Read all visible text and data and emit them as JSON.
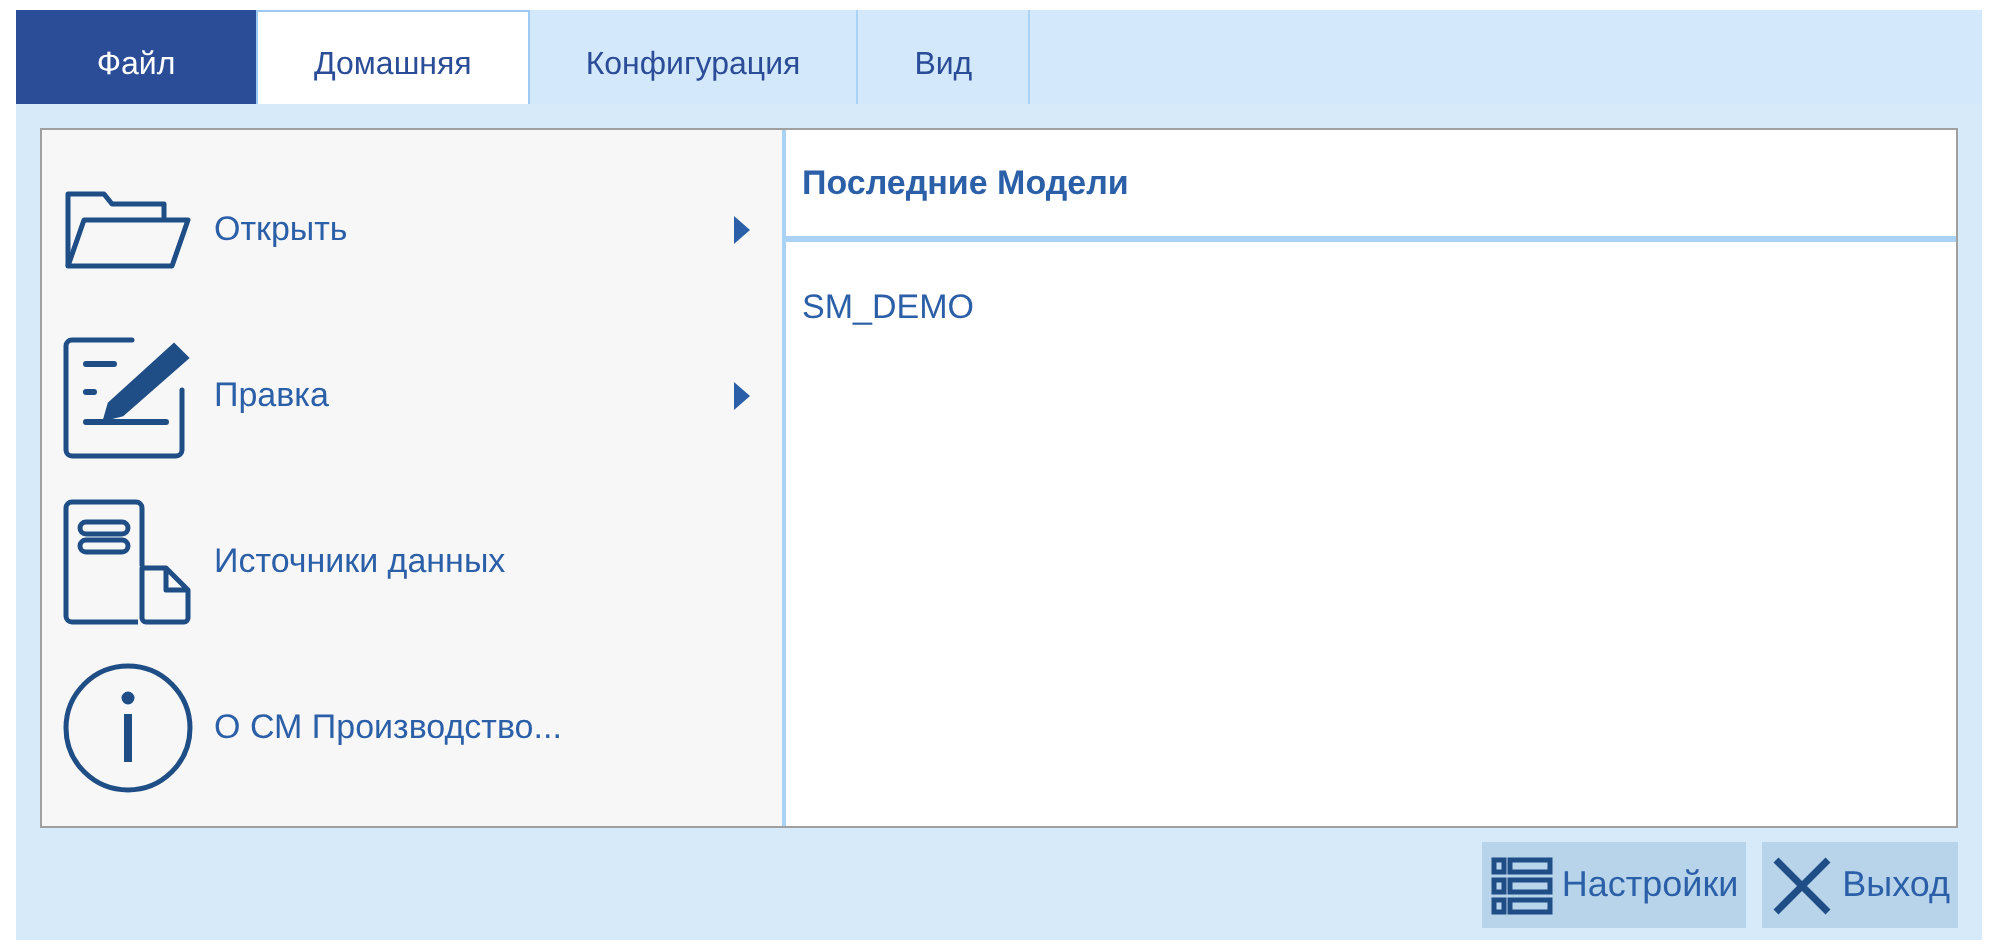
{
  "tabs": [
    {
      "label": "Файл",
      "selected": false,
      "kind": "file"
    },
    {
      "label": "Домашняя",
      "selected": true,
      "kind": "tab"
    },
    {
      "label": "Конфигурация",
      "selected": false,
      "kind": "tab"
    },
    {
      "label": "Вид",
      "selected": false,
      "kind": "tab"
    }
  ],
  "menu": {
    "items": [
      {
        "label": "Открыть",
        "has_submenu": true
      },
      {
        "label": "Правка",
        "has_submenu": true
      },
      {
        "label": "Источники данных",
        "has_submenu": false
      },
      {
        "label": "О СМ Производство...",
        "has_submenu": false
      }
    ]
  },
  "recent": {
    "title": "Последние Модели",
    "items": [
      "SM_DEMO"
    ]
  },
  "buttons": [
    {
      "label": "Настройки",
      "kind": "settings"
    },
    {
      "label": "Выход",
      "kind": "exit"
    }
  ]
}
